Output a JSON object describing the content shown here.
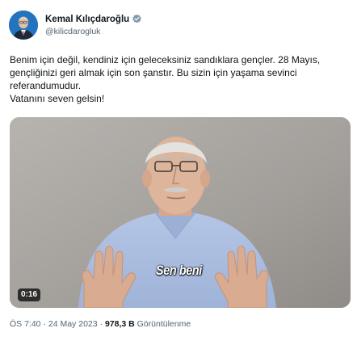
{
  "author": {
    "name": "Kemal Kılıçdaroğlu",
    "handle": "@kilicdarogluk",
    "verified": true
  },
  "tweet": {
    "line1": "Benim için değil, kendiniz için geleceksiniz sandıklara gençler. 28 Mayıs,",
    "line2": "gençliğinizi geri almak için son şanstır. Bu sizin için yaşama sevinci",
    "line3": "referandumudur.",
    "line4": "Vatanını seven gelsin!"
  },
  "media": {
    "type": "video",
    "caption": "Sen beni",
    "duration": "0:16"
  },
  "meta": {
    "time": "ÖS 7:40",
    "separator1": " · ",
    "date": "24 May 2023",
    "separator2": " · ",
    "views_count": "978,3 B",
    "views_label": " Görüntülenme"
  },
  "colors": {
    "text": "#0f1419",
    "secondary": "#536471",
    "verified": "#829aab",
    "shirt": "#a9bde0"
  }
}
